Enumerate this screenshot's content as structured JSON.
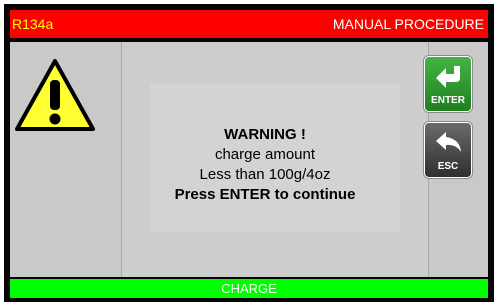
{
  "header": {
    "refrigerant": "R134a",
    "procedure": "MANUAL PROCEDURE"
  },
  "message": {
    "title": "WARNING !",
    "line1": "charge amount",
    "line2": "Less than 100g/4oz",
    "instruction": "Press ENTER to continue"
  },
  "buttons": {
    "enter_label": "ENTER",
    "esc_label": "ESC"
  },
  "footer": {
    "mode": "CHARGE"
  },
  "icons": {
    "warning": "warning-triangle-icon",
    "enter": "enter-return-arrow-icon",
    "esc": "back-arrow-icon"
  },
  "colors": {
    "header": "#fe0000",
    "refrigerant_text": "#ffff00",
    "footer": "#00ff00",
    "enter_button": "#2e9a2e",
    "esc_button": "#444444",
    "warning_triangle": "#ffff33"
  }
}
